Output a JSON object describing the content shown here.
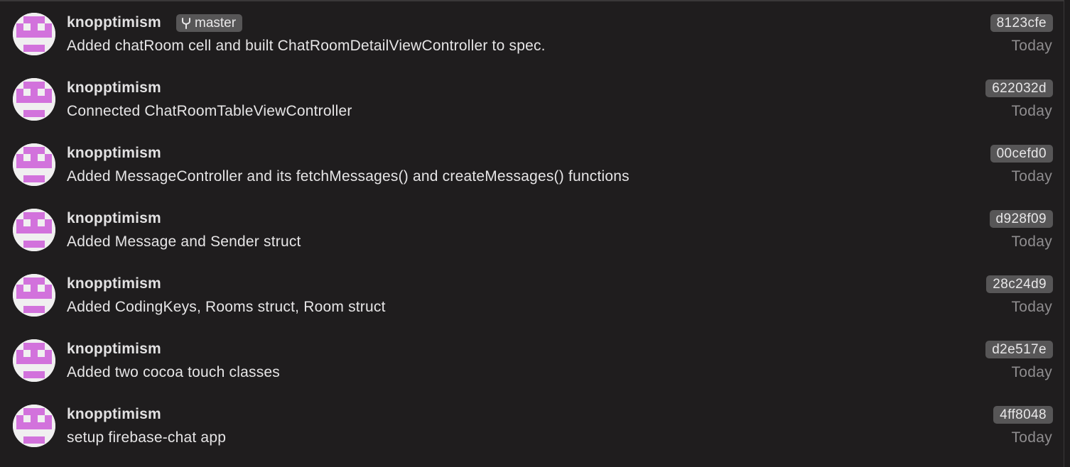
{
  "colors": {
    "background": "#1f1d1e",
    "avatar_pink": "#d272dc",
    "avatar_bg": "#f0eff0",
    "badge_bg": "#575657",
    "date_text": "#8f8d8f"
  },
  "branch": {
    "icon": "branch-icon",
    "label": "master"
  },
  "commits": [
    {
      "author": "knopptimism",
      "message": "Added chatRoom cell and built ChatRoomDetailViewController to spec.",
      "hash": "8123cfe",
      "date": "Today"
    },
    {
      "author": "knopptimism",
      "message": "Connected ChatRoomTableViewController",
      "hash": "622032d",
      "date": "Today"
    },
    {
      "author": "knopptimism",
      "message": "Added MessageController and its fetchMessages() and createMessages() functions",
      "hash": "00cefd0",
      "date": "Today"
    },
    {
      "author": "knopptimism",
      "message": "Added Message and Sender struct",
      "hash": "d928f09",
      "date": "Today"
    },
    {
      "author": "knopptimism",
      "message": "Added CodingKeys, Rooms struct, Room struct",
      "hash": "28c24d9",
      "date": "Today"
    },
    {
      "author": "knopptimism",
      "message": "Added two cocoa touch classes",
      "hash": "d2e517e",
      "date": "Today"
    },
    {
      "author": "knopptimism",
      "message": "setup firebase-chat app",
      "hash": "4ff8048",
      "date": "Today"
    }
  ]
}
